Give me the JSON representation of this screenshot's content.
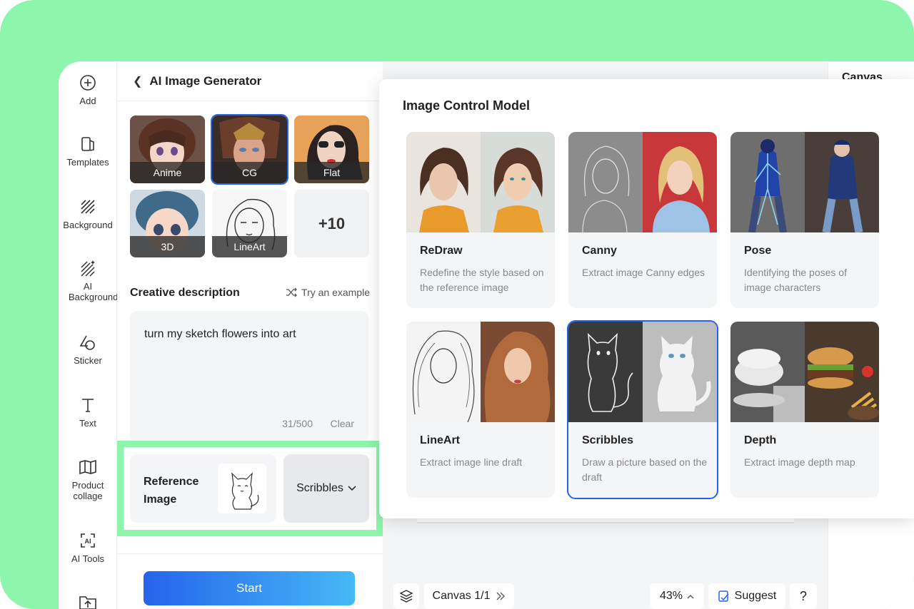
{
  "toolbar": {
    "items": [
      {
        "label": "Add",
        "icon": "plus-circle-icon"
      },
      {
        "label": "Templates",
        "icon": "templates-icon"
      },
      {
        "label": "Background",
        "icon": "hatch-icon"
      },
      {
        "label": "AI Background",
        "icon": "ai-background-icon"
      },
      {
        "label": "Sticker",
        "icon": "sticker-icon"
      },
      {
        "label": "Text",
        "icon": "text-icon"
      },
      {
        "label": "Product collage",
        "icon": "collage-icon"
      },
      {
        "label": "AI Tools",
        "icon": "ai-tools-icon"
      }
    ]
  },
  "panel": {
    "title": "AI Image Generator",
    "styles": [
      {
        "label": "Anime"
      },
      {
        "label": "CG",
        "selected": true
      },
      {
        "label": "Flat"
      },
      {
        "label": "3D"
      },
      {
        "label": "LineArt"
      }
    ],
    "more_styles": "+10",
    "description": {
      "title": "Creative description",
      "try_example": "Try an example",
      "text": "turn my sketch flowers into art",
      "count": "31/500",
      "clear": "Clear"
    },
    "reference": {
      "label": "Reference Image",
      "model_button": "Scribbles"
    },
    "start": "Start"
  },
  "right_panel": {
    "title": "Canvas"
  },
  "bottom_bar": {
    "canvas": "Canvas 1/1",
    "zoom": "43%",
    "suggest": "Suggest",
    "help": "?"
  },
  "popup": {
    "title": "Image Control Model",
    "models": [
      {
        "name": "ReDraw",
        "desc": "Redefine the style based on the reference image"
      },
      {
        "name": "Canny",
        "desc": "Extract image Canny edges"
      },
      {
        "name": "Pose",
        "desc": "Identifying the poses of image characters"
      },
      {
        "name": "LineArt",
        "desc": "Extract image line draft"
      },
      {
        "name": "Scribbles",
        "desc": "Draw a picture based on the draft",
        "selected": true
      },
      {
        "name": "Depth",
        "desc": "Extract image depth map"
      }
    ]
  },
  "colors": {
    "accent": "#2563eb",
    "highlight": "#8ef5ac"
  }
}
